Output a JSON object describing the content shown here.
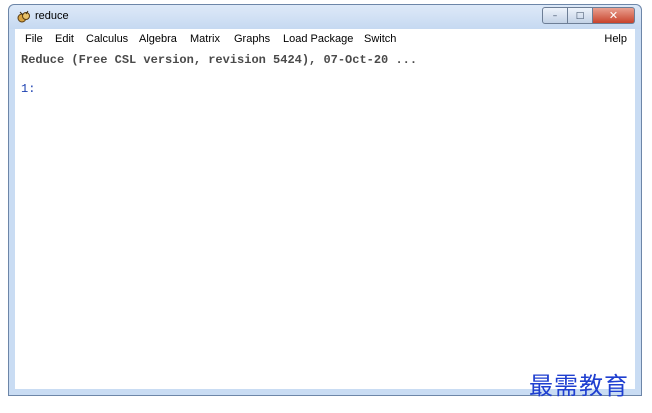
{
  "window": {
    "title": "reduce",
    "controls": {
      "minimize": "–",
      "maximize": "□",
      "close": "✕"
    }
  },
  "menubar": {
    "items": [
      {
        "label": "File",
        "name": "menu-file"
      },
      {
        "label": "Edit",
        "name": "menu-edit"
      },
      {
        "label": "Calculus",
        "name": "menu-calculus"
      },
      {
        "label": "Algebra",
        "name": "menu-algebra"
      },
      {
        "label": "Matrix",
        "name": "menu-matrix"
      },
      {
        "label": "Graphs",
        "name": "menu-graphs"
      },
      {
        "label": "Load Package",
        "name": "menu-load-package"
      },
      {
        "label": "Switch",
        "name": "menu-switch"
      }
    ],
    "help": "Help"
  },
  "console": {
    "banner": "Reduce (Free CSL version, revision 5424), 07-Oct-20 ...",
    "prompt": "1:"
  },
  "watermark": "最需教育",
  "colors": {
    "titlebar": "#c9dcf3",
    "close_button": "#c8432c",
    "prompt_text": "#1a3fb0",
    "watermark": "#1f3fd0"
  }
}
